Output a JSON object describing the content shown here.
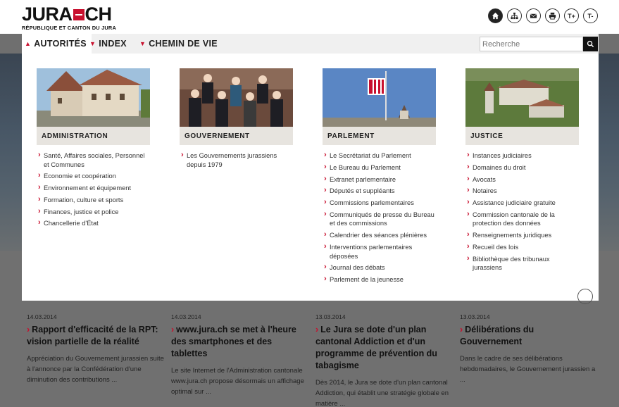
{
  "logo": {
    "word_left": "JURA",
    "word_right": "CH",
    "subtitle": "RÉPUBLIQUE ET CANTON DU JURA"
  },
  "tools": [
    {
      "name": "home-icon",
      "label": ""
    },
    {
      "name": "sitemap-icon",
      "label": ""
    },
    {
      "name": "mail-icon",
      "label": ""
    },
    {
      "name": "print-icon",
      "label": ""
    },
    {
      "name": "font-increase-icon",
      "label": "T+"
    },
    {
      "name": "font-decrease-icon",
      "label": "T-"
    }
  ],
  "nav": {
    "items": [
      {
        "label": "AUTORITÉS",
        "chevron": "▲"
      },
      {
        "label": "INDEX",
        "chevron": "▼"
      },
      {
        "label": "CHEMIN DE VIE",
        "chevron": "▼"
      }
    ],
    "search_placeholder": "Recherche"
  },
  "menu": {
    "columns": [
      {
        "heading": "ADMINISTRATION",
        "links": [
          "Santé, Affaires sociales, Personnel et Communes",
          "Economie et coopération",
          "Environnement et équipement",
          "Formation, culture et sports",
          "Finances, justice et police",
          "Chancellerie d'État"
        ]
      },
      {
        "heading": "GOUVERNEMENT",
        "links": [
          "Les Gouvernements jurassiens depuis 1979"
        ]
      },
      {
        "heading": "PARLEMENT",
        "links": [
          "Le Secrétariat du Parlement",
          "Le Bureau du Parlement",
          "Extranet parlementaire",
          "Députés et suppléants",
          "Commissions parlementaires",
          "Communiqués de presse du Bureau et des commissions",
          "Calendrier des séances plénières",
          "Interventions parlementaires déposées",
          "Journal des débats",
          "Parlement de la jeunesse"
        ]
      },
      {
        "heading": "JUSTICE",
        "links": [
          "Instances judiciaires",
          "Domaines du droit",
          "Avocats",
          "Notaires",
          "Assistance judiciaire gratuite",
          "Commission cantonale de la protection des données",
          "Renseignements juridiques",
          "Recueil des lois",
          "Bibliothèque des tribunaux jurassiens"
        ]
      }
    ]
  },
  "news": [
    {
      "date": "14.03.2014",
      "title": "Rapport d'efficacité de la RPT: vision partielle de la réalité",
      "text": "Appréciation du Gouvernement jurassien suite à l'annonce par la Confédération d'une diminution des contributions ..."
    },
    {
      "date": "14.03.2014",
      "title": "www.jura.ch se met à l'heure des smartphones et des tablettes",
      "text": "Le site Internet de l'Administration cantonale www.jura.ch propose désormais un affichage optimal sur ..."
    },
    {
      "date": "13.03.2014",
      "title": "Le Jura se dote d'un plan cantonal Addiction et d'un programme de prévention du tabagisme",
      "text": "Dès 2014, le Jura se dote d'un plan cantonal Addiction, qui établit une stratégie globale en matière ..."
    },
    {
      "date": "13.03.2014",
      "title": "Délibérations du Gouvernement",
      "text": "Dans le cadre de ses délibérations hebdomadaires, le Gouvernement jurassien a ..."
    }
  ],
  "colors": {
    "accent": "#c8102e",
    "nav_bg": "#f0f0f0",
    "heading_bg": "#e7e4df"
  }
}
